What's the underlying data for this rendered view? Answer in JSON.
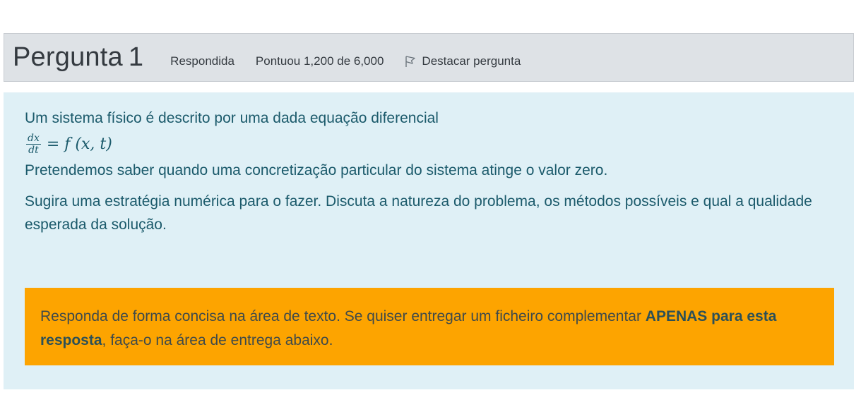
{
  "question": {
    "title_prefix": "Pergunta",
    "number": "1",
    "status": "Respondida",
    "score": "Pontuou 1,200 de 6,000",
    "flag_label": "Destacar pergunta"
  },
  "body": {
    "intro": "Um sistema físico é descrito por uma dada equação diferencial",
    "equation": {
      "numerator": "dx",
      "denominator": "dt",
      "rhs": "= f (x, t)"
    },
    "paragraph_1": "Pretendemos saber quando uma concretização particular do sistema atinge o valor zero.",
    "paragraph_2": "Sugira uma estratégia numérica para o fazer. Discuta a natureza do problema, os métodos possíveis e qual a qualidade esperada da solução."
  },
  "notice": {
    "text_before": "Responda de forma concisa na área de texto. Se quiser entregar um ficheiro complementar ",
    "bold_text": "APENAS para esta resposta",
    "text_after": ", faça-o na área de entrega abaixo."
  },
  "colors": {
    "info_bar_bg": "#dee2e6",
    "content_bg": "#dff0f6",
    "content_text": "#1b5a6b",
    "notice_bg": "#fda400"
  },
  "icons": {
    "flag": "flag-outline-icon"
  }
}
